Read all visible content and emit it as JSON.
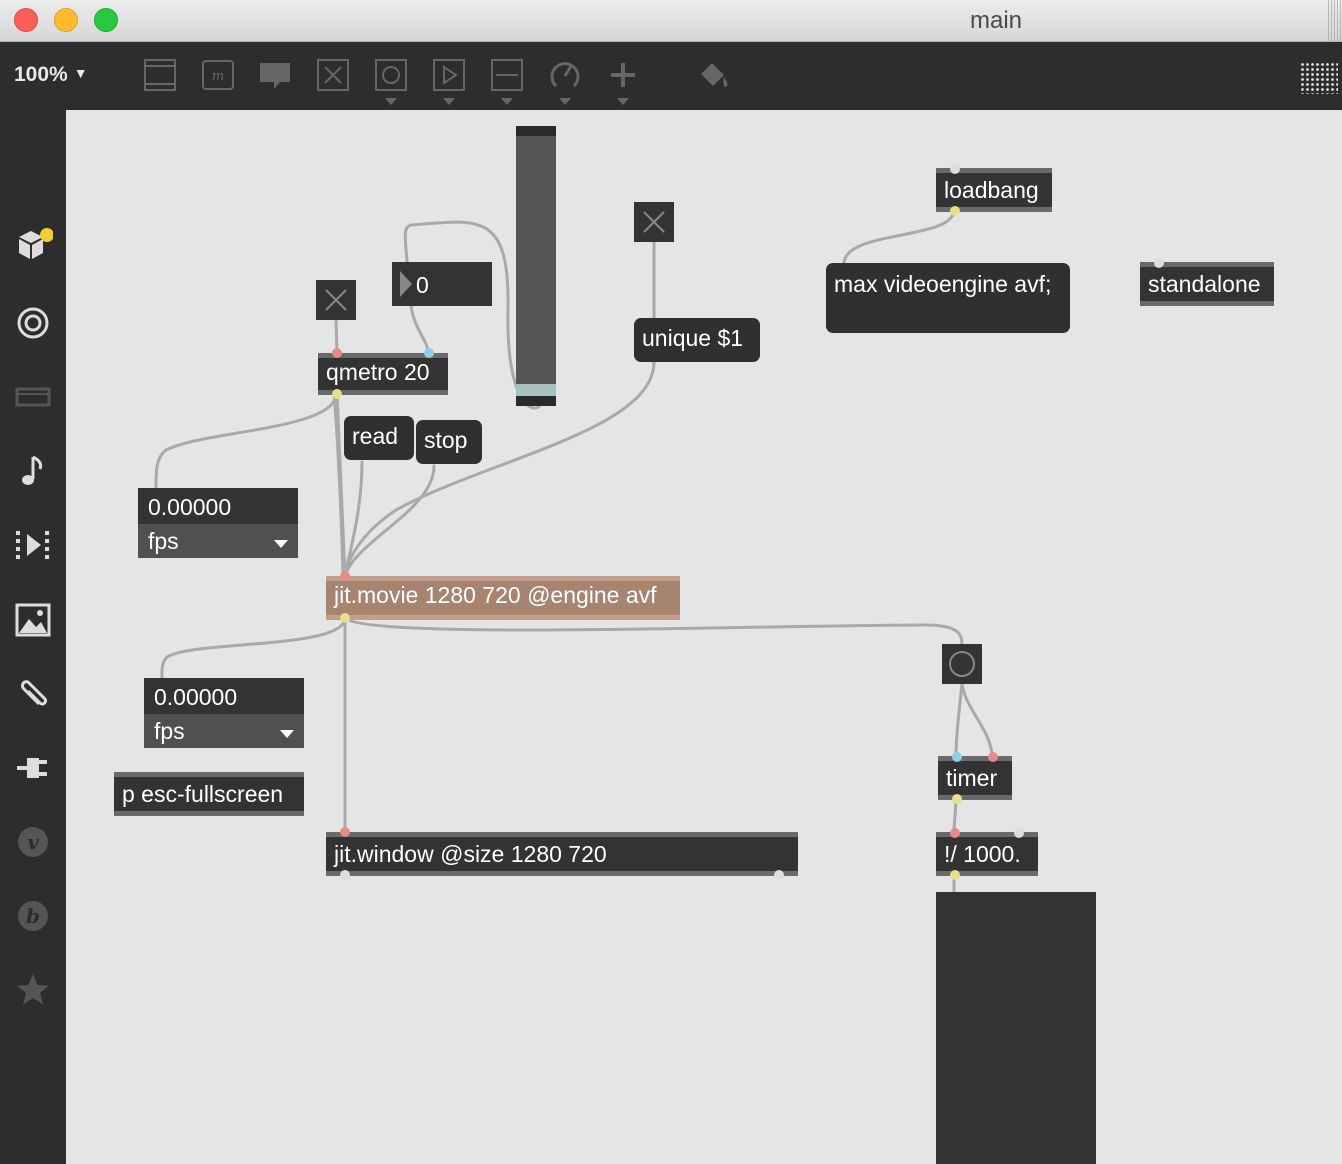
{
  "window": {
    "title": "main"
  },
  "toolbar": {
    "zoom": "100%",
    "icons": [
      "object-box-icon",
      "message-box-icon",
      "comment-icon",
      "toggle-icon",
      "button-icon",
      "play-icon",
      "slider-icon",
      "dial-icon",
      "add-icon",
      "paint-bucket-icon",
      "grid-icon"
    ]
  },
  "sidebar": {
    "icons": [
      "packages-icon",
      "target-icon",
      "panel-icon",
      "music-note-icon",
      "video-icon",
      "image-icon",
      "paperclip-icon",
      "plug-icon",
      "vizzie-icon",
      "beap-icon",
      "star-icon"
    ]
  },
  "patch": {
    "loadbang": "loadbang",
    "videoengine_msg": "max videoengine avf;",
    "standalone": "standalone",
    "unique_msg": "unique $1",
    "number_value": "0",
    "qmetro": "qmetro 20",
    "read_msg": "read",
    "stop_msg": "stop",
    "fps1_value": "0.00000",
    "fps1_unit": "fps",
    "jit_movie": "jit.movie 1280 720 @engine avf",
    "fps2_value": "0.00000",
    "fps2_unit": "fps",
    "esc_fullscreen": "p esc-fullscreen",
    "jit_window": "jit.window @size 1280 720",
    "timer": "timer",
    "divide": "!/ 1000."
  },
  "colors": {
    "canvas": "#e5e5e5",
    "object": "#333333",
    "jit_movie": "#a68470",
    "inlet_red": "#e88a8a",
    "inlet_blue": "#8ccfe8",
    "outlet_yellow": "#e6e08a",
    "patch_cord": "#a9a9a9"
  }
}
